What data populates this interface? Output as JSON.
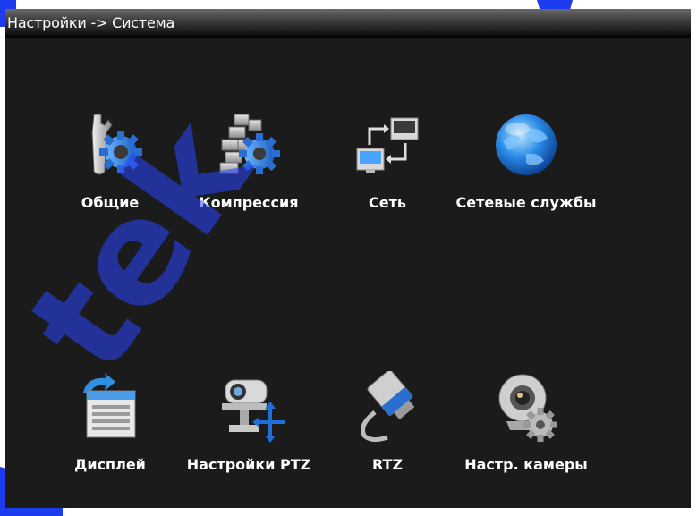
{
  "window": {
    "title": "Настройки -> Система"
  },
  "tiles": [
    {
      "label": "Общие",
      "icon": "wrench-gear-icon"
    },
    {
      "label": "Компрессия",
      "icon": "bricks-gear-icon"
    },
    {
      "label": "Сеть",
      "icon": "network-icon"
    },
    {
      "label": "Сетевые службы",
      "icon": "globe-icon"
    },
    {
      "label": "Дисплей",
      "icon": "display-icon"
    },
    {
      "label": "Настройки PTZ",
      "icon": "ptz-camera-icon"
    },
    {
      "label": "RTZ",
      "icon": "serial-cable-icon"
    },
    {
      "label": "Настр. камеры",
      "icon": "webcam-gear-icon"
    }
  ],
  "watermark": "tek",
  "colors": {
    "window_bg": "#1b1b1b",
    "label": "#ffffff",
    "watermark": "#1d3cf0"
  }
}
